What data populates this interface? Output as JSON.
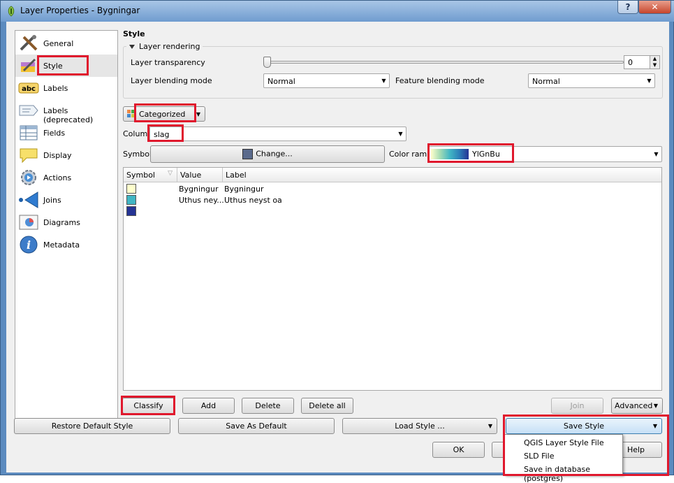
{
  "window": {
    "title": "Layer Properties - Bygningar"
  },
  "sidebar": {
    "items": [
      {
        "label": "General",
        "icon": "tools-icon"
      },
      {
        "label": "Style",
        "icon": "paint-brush-icon"
      },
      {
        "label": "Labels",
        "icon": "abc-icon"
      },
      {
        "label": "Labels (deprecated)",
        "icon": "label-icon"
      },
      {
        "label": "Fields",
        "icon": "table-icon"
      },
      {
        "label": "Display",
        "icon": "speech-bubble-icon"
      },
      {
        "label": "Actions",
        "icon": "gear-play-icon"
      },
      {
        "label": "Joins",
        "icon": "join-arrow-icon"
      },
      {
        "label": "Diagrams",
        "icon": "diagram-icon"
      },
      {
        "label": "Metadata",
        "icon": "info-icon"
      }
    ],
    "abc_text": "abc"
  },
  "style": {
    "heading": "Style",
    "layer_rendering": "Layer rendering",
    "transparency_label": "Layer transparency",
    "transparency_value": "0",
    "blending_label": "Layer blending mode",
    "blending_value": "Normal",
    "feature_blending_label": "Feature blending mode",
    "feature_blending_value": "Normal",
    "renderer": "Categorized",
    "column_label": "Column",
    "column_value": "slag",
    "symbol_label": "Symbol",
    "change_button": "Change...",
    "color_ramp_label": "Color ramp",
    "color_ramp_value": "YlGnBu",
    "symbol_color": "#5a6a8c"
  },
  "table": {
    "headers": [
      "Symbol",
      "Value",
      "Label"
    ],
    "rows": [
      {
        "color": "#ffffcc",
        "value": "Bygningur",
        "label": "Bygningur"
      },
      {
        "color": "#41b6c4",
        "value": "Uthus ney...",
        "label": "Uthus neyst oa"
      },
      {
        "color": "#253494",
        "value": "",
        "label": ""
      }
    ]
  },
  "buttons": {
    "classify": "Classify",
    "add": "Add",
    "delete": "Delete",
    "delete_all": "Delete all",
    "join": "Join",
    "advanced": "Advanced",
    "restore_default": "Restore Default Style",
    "save_as_default": "Save As Default",
    "load_style": "Load Style ...",
    "save_style": "Save Style",
    "ok": "OK",
    "help": "Help"
  },
  "save_menu": {
    "items": [
      "QGIS Layer Style File",
      "SLD File",
      "Save in database (postgres)"
    ]
  }
}
